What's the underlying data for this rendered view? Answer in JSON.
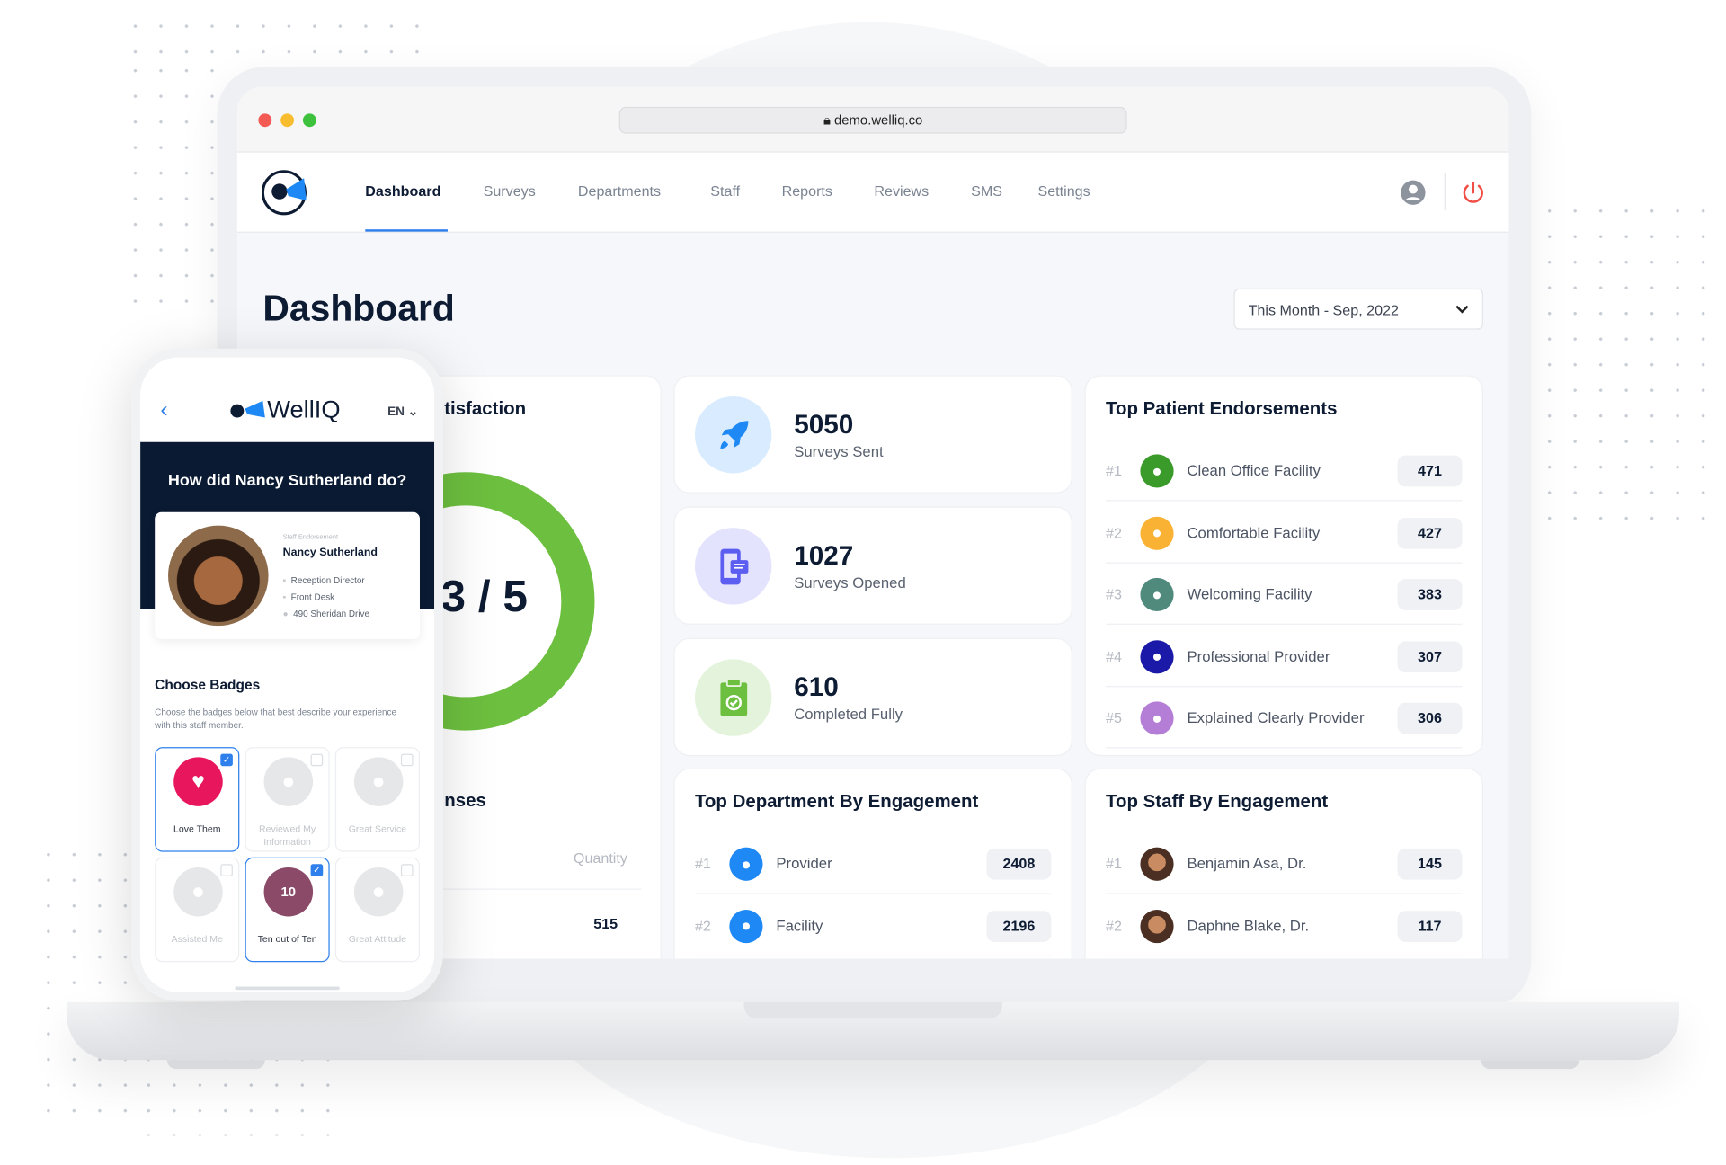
{
  "browser": {
    "url": "demo.welliq.co"
  },
  "nav": {
    "items": [
      "Dashboard",
      "Surveys",
      "Departments",
      "Staff",
      "Reports",
      "Reviews",
      "SMS",
      "Settings"
    ],
    "active": "Dashboard"
  },
  "page": {
    "title": "Dashboard",
    "date_filter": "This Month - Sep, 2022"
  },
  "satisfaction": {
    "title_partial": "tisfaction",
    "score_partial": "3 / 5",
    "ring_color": "#6dbf3f"
  },
  "responses": {
    "title_partial": "nses",
    "column": "Quantity",
    "value": "515"
  },
  "stats": [
    {
      "value": "5050",
      "label": "Surveys Sent",
      "icon": "rocket-icon",
      "color": "#1e88f5",
      "bg": "#d9ebff"
    },
    {
      "value": "1027",
      "label": "Surveys Opened",
      "icon": "mobile-chat-icon",
      "color": "#5b5ef0",
      "bg": "#e3e3fd"
    },
    {
      "value": "610",
      "label": "Completed Fully",
      "icon": "clipboard-check-icon",
      "color": "#6dbf3f",
      "bg": "#e4f4dc"
    }
  ],
  "endorsements": {
    "title": "Top Patient Endorsements",
    "items": [
      {
        "rank": "#1",
        "label": "Clean Office Facility",
        "value": "471",
        "icon": "broom-icon",
        "color": "#3a9a2a"
      },
      {
        "rank": "#2",
        "label": "Comfortable Facility",
        "value": "427",
        "icon": "recliner-icon",
        "color": "#f9b233"
      },
      {
        "rank": "#3",
        "label": "Welcoming Facility",
        "value": "383",
        "icon": "house-heart-icon",
        "color": "#4f8a7d"
      },
      {
        "rank": "#4",
        "label": "Professional Provider",
        "value": "307",
        "icon": "handshake-icon",
        "color": "#1b1aa8"
      },
      {
        "rank": "#5",
        "label": "Explained Clearly Provider",
        "value": "306",
        "icon": "people-talking-icon",
        "color": "#b57ed6"
      }
    ]
  },
  "departments": {
    "title": "Top Department By Engagement",
    "items": [
      {
        "rank": "#1",
        "label": "Provider",
        "value": "2408",
        "icon": "doctor-icon",
        "color": "#1e88f5"
      },
      {
        "rank": "#2",
        "label": "Facility",
        "value": "2196",
        "icon": "building-icon",
        "color": "#1e88f5"
      }
    ]
  },
  "staff": {
    "title": "Top Staff By Engagement",
    "items": [
      {
        "rank": "#1",
        "label": "Benjamin Asa, Dr.",
        "value": "145"
      },
      {
        "rank": "#2",
        "label": "Daphne Blake, Dr.",
        "value": "117"
      }
    ]
  },
  "phone": {
    "brand": "WellIQ",
    "lang": "EN",
    "question": "How did Nancy Sutherland do?",
    "profile": {
      "kicker": "Staff Endorsement",
      "name": "Nancy Sutherland",
      "role": "Reception Director",
      "dept": "Front Desk",
      "address": "490 Sheridan Drive"
    },
    "badges_title": "Choose Badges",
    "badges_desc": "Choose the badges below that best describe your experience with this staff member.",
    "badges": [
      {
        "label": "Love Them",
        "selected": true,
        "color": "#e8175d"
      },
      {
        "label": "Reviewed My Information",
        "selected": false
      },
      {
        "label": "Great Service",
        "selected": false
      },
      {
        "label": "Assisted Me",
        "selected": false
      },
      {
        "label": "Ten out of Ten",
        "selected": true,
        "color": "#8b4a68"
      },
      {
        "label": "Great Attitude",
        "selected": false
      }
    ]
  }
}
